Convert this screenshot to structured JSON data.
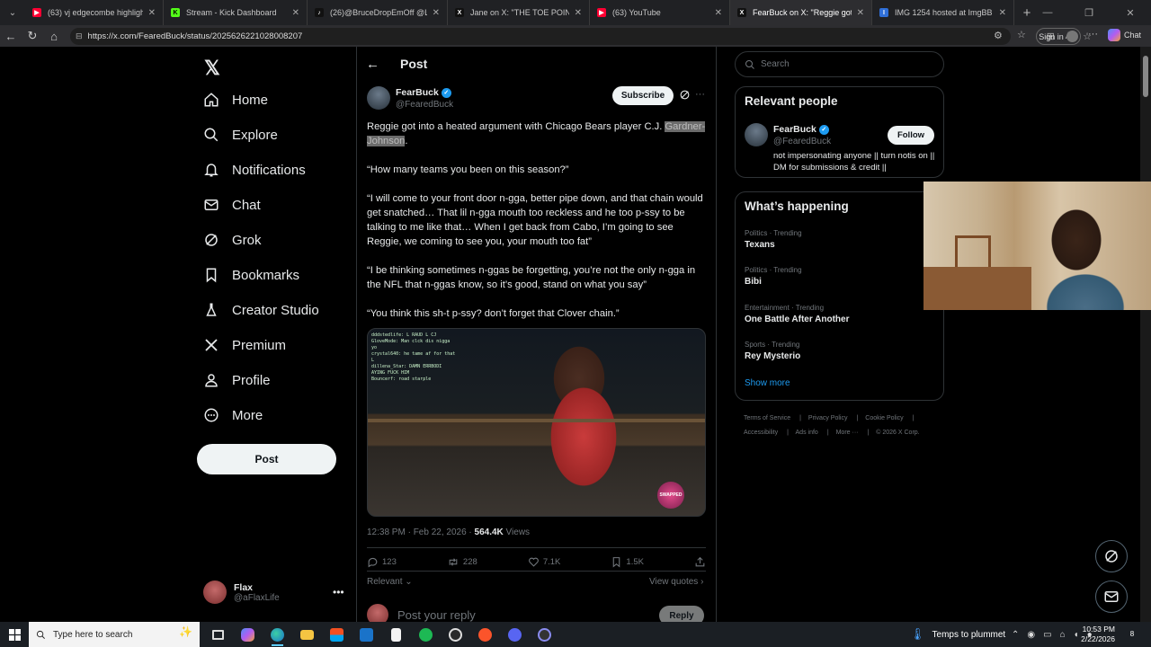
{
  "browser": {
    "tabs": [
      {
        "title": "(63) vj edgecombe highlights - Yo",
        "color": "#ff0033",
        "glyph": "▶"
      },
      {
        "title": "Stream - Kick Dashboard",
        "color": "#53fc18",
        "glyph": "K"
      },
      {
        "title": "(26)@BruceDropEmOff @Livewith...",
        "color": "#111111",
        "glyph": "♪"
      },
      {
        "title": "Jane on X: \"THE TOE POINT STAN",
        "color": "#111111",
        "glyph": "X"
      },
      {
        "title": "(63) YouTube",
        "color": "#ff0033",
        "glyph": "▶"
      },
      {
        "title": "FearBuck on X: \"Reggie got in",
        "color": "#111111",
        "glyph": "X"
      },
      {
        "title": "IMG 1254 hosted at ImgBB — Img",
        "color": "#2f6fd8",
        "glyph": "I"
      }
    ],
    "url": "https://x.com/FearedBuck/status/2025626221028008207",
    "signin_label": "Sign in",
    "chat_label": "Chat"
  },
  "sidebar": {
    "items": [
      {
        "label": "Home",
        "icon": "home-icon"
      },
      {
        "label": "Explore",
        "icon": "search-icon"
      },
      {
        "label": "Notifications",
        "icon": "bell-icon"
      },
      {
        "label": "Chat",
        "icon": "mail-icon"
      },
      {
        "label": "Grok",
        "icon": "grok-icon"
      },
      {
        "label": "Bookmarks",
        "icon": "bookmark-icon"
      },
      {
        "label": "Creator Studio",
        "icon": "flask-icon"
      },
      {
        "label": "Premium",
        "icon": "x-icon"
      },
      {
        "label": "Profile",
        "icon": "person-icon"
      },
      {
        "label": "More",
        "icon": "more-circle-icon"
      }
    ],
    "post_button": "Post",
    "account": {
      "name": "Flax",
      "handle": "@aFlaxLife"
    }
  },
  "post": {
    "header_title": "Post",
    "author_name": "FearBuck",
    "author_handle": "@FearedBuck",
    "subscribe_label": "Subscribe",
    "text_p1_a": "Reggie got into a heated argument with Chicago Bears player C.J.",
    "text_p1_hl": "Gardner-Johnson",
    "text_p1_b": ".",
    "text_p2": "“How many teams you been on this season?”",
    "text_p3": "“I will come to your front door n-gga, better pipe down, and that chain would get snatched… That lil n-gga mouth too reckless and he too p-ssy to be talking to me like that… When I get back from Cabo, I’m going to see Reggie, we coming to see you, your mouth too fat”",
    "text_p4": "“I be thinking sometimes n-ggas be forgetting, you’re not the only n-gga in the NFL that n-ggas know, so it’s good, stand on what you say”",
    "text_p5": "“You think this sh-t p-ssy? don’t forget that Clover chain.”",
    "media_chat": [
      "dddstedlife: L RAUD L CJ",
      "GloveMode: Man clck dis nigga",
      "yo",
      "crystal640: he tame af for that",
      "L",
      "dillena_Star: DAMN ERRBODI",
      "AYING FUCK HIM",
      "Bouncerf: road starple"
    ],
    "media_badge": "SWAPPED",
    "time": "12:38 PM · Feb 22, 2026 · ",
    "views_count": "564.4K",
    "views_label": " Views",
    "replies": "123",
    "reposts": "228",
    "likes": "7.1K",
    "bookmarks": "1.5K",
    "relevant_label": "Relevant",
    "view_quotes_label": "View quotes",
    "reply_placeholder": "Post your reply",
    "reply_button": "Reply"
  },
  "right": {
    "search_placeholder": "Search",
    "relevant_people_title": "Relevant people",
    "person": {
      "name": "FearBuck",
      "handle": "@FearedBuck",
      "bio": "not impersonating anyone || turn notis on || DM for submissions & credit ||",
      "follow_label": "Follow"
    },
    "whats_happening_title": "What’s happening",
    "trends": [
      {
        "context": "Politics · Trending",
        "title": "Texans"
      },
      {
        "context": "Politics · Trending",
        "title": "Bibi"
      },
      {
        "context": "Entertainment · Trending",
        "title": "One Battle After Another"
      },
      {
        "context": "Sports · Trending",
        "title": "Rey Mysterio"
      }
    ],
    "show_more": "Show more",
    "footer": [
      "Terms of Service",
      "Privacy Policy",
      "Cookie Policy",
      "Accessibility",
      "Ads info",
      "More ···",
      "© 2026 X Corp."
    ]
  },
  "taskbar": {
    "search_placeholder": "Type here to search",
    "weather": "Temps to plummet",
    "time": "10:53 PM",
    "date": "2/22/2026",
    "notifications": "8"
  }
}
